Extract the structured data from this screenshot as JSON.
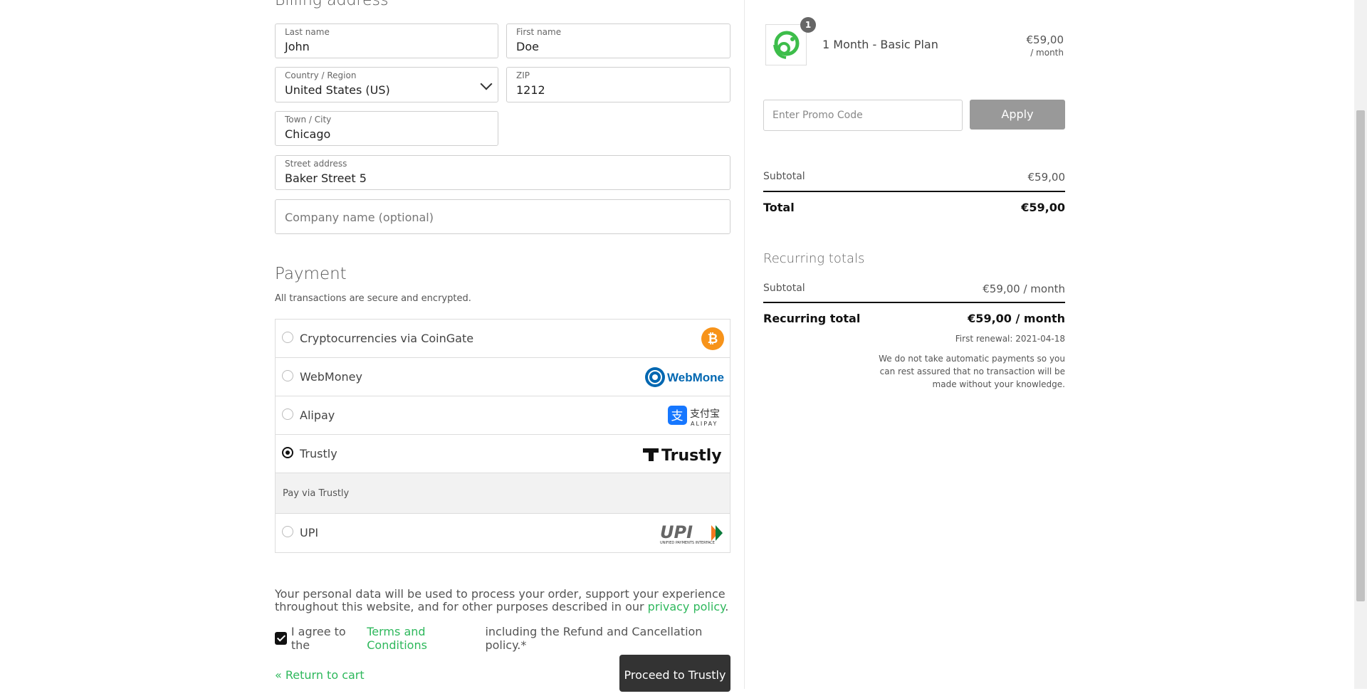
{
  "billing": {
    "heading": "Billing address",
    "last_name": {
      "label": "Last name",
      "value": "John"
    },
    "first_name": {
      "label": "First name",
      "value": "Doe"
    },
    "country": {
      "label": "Country / Region",
      "value": "United States (US)"
    },
    "zip": {
      "label": "ZIP",
      "value": "1212"
    },
    "city": {
      "label": "Town / City",
      "value": "Chicago"
    },
    "street": {
      "label": "Street address",
      "value": "Baker Street 5"
    },
    "company": {
      "placeholder": "Company name (optional)"
    }
  },
  "payment": {
    "heading": "Payment",
    "secure_note": "All transactions are secure and encrypted.",
    "methods": [
      {
        "label": "Cryptocurrencies via CoinGate",
        "icon": "bitcoin-icon",
        "selected": false
      },
      {
        "label": "WebMoney",
        "icon": "webmoney-logo",
        "selected": false
      },
      {
        "label": "Alipay",
        "icon": "alipay-logo",
        "selected": false
      },
      {
        "label": "Trustly",
        "icon": "trustly-logo",
        "selected": true
      },
      {
        "label": "UPI",
        "icon": "upi-logo",
        "selected": false
      }
    ],
    "trustly_description": "Pay via Trustly",
    "logo_text": {
      "webmoney": "WebMoney",
      "alipay_cn": "支付宝",
      "alipay_en": "ALIPAY",
      "trustly": "Trustly",
      "upi": "UPI",
      "upi_sub": "UNIFIED PAYMENTS INTERFACE"
    }
  },
  "privacy": {
    "text": "Your personal data will be used to process your order, support your experience throughout this website, and for other purposes described in our ",
    "link": "privacy policy",
    "end": "."
  },
  "terms": {
    "before": "I agree to the ",
    "link": "Terms and Conditions",
    "after": " including the Refund and Cancellation policy.*",
    "checked": true
  },
  "return_link": "« Return to cart",
  "proceed_button": "Proceed to Trustly",
  "summary": {
    "quantity_badge": "1",
    "product_name": "1 Month - Basic Plan",
    "product_price": "€59,00",
    "product_period": "/ month",
    "promo_placeholder": "Enter Promo Code",
    "apply_label": "Apply",
    "subtotal_label": "Subtotal",
    "subtotal_value": "€59,00",
    "total_label": "Total",
    "total_value": "€59,00",
    "recurring_heading": "Recurring totals",
    "recurring_subtotal_label": "Subtotal",
    "recurring_subtotal_value": "€59,00 / month",
    "recurring_total_label": "Recurring total",
    "recurring_total_value": "€59,00 / month",
    "first_renewal": "First renewal: 2021-04-18",
    "note": "We do not take automatic payments so you can rest assured that no transaction will be made without your knowledge."
  },
  "colors": {
    "accent_green": "#2eb85c",
    "button_dark": "#333333",
    "apply_gray": "#999999"
  }
}
